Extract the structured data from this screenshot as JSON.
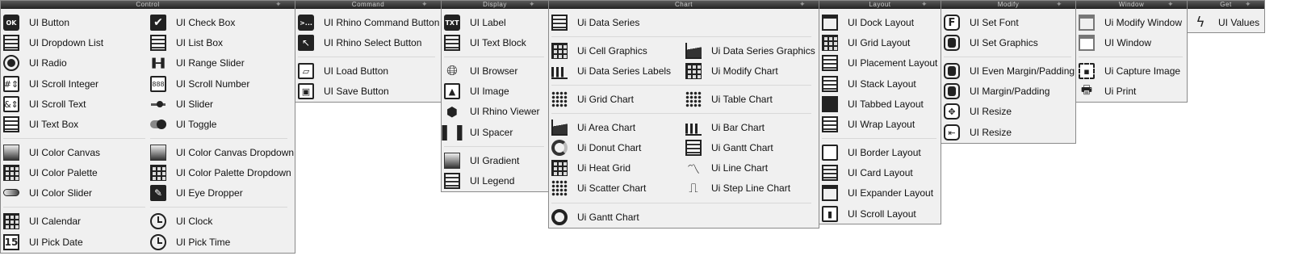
{
  "panels": {
    "control": "Control",
    "command": "Command",
    "display": "Display",
    "chart": "Chart",
    "layout": "Layout",
    "modify": "Modify",
    "window": "Window",
    "get": "Get"
  },
  "control": {
    "col1": [
      "UI Button",
      "UI Dropdown List",
      "UI Radio",
      "UI Scroll Integer",
      "UI Scroll Text",
      "UI Text Box",
      "UI Color Canvas",
      "UI Color Palette",
      "UI Color Slider",
      "UI Calendar",
      "UI Pick Date"
    ],
    "col2": [
      "UI Check Box",
      "UI List Box",
      "UI Range Slider",
      "UI Scroll Number",
      "UI Slider",
      "UI Toggle",
      "UI Color Canvas Dropdown",
      "UI Color Palette Dropdown",
      "UI Eye Dropper",
      "UI Clock",
      "UI Pick Time"
    ],
    "button_icon": "OK",
    "pick_date_icon": "15"
  },
  "command": {
    "items": [
      "UI Rhino Command Button",
      "UI Rhino Select Button",
      "UI Load Button",
      "UI Save Button"
    ],
    "command_icon": ">..."
  },
  "display": {
    "items": [
      "UI Label",
      "UI Text Block",
      "UI Browser",
      "UI Image",
      "UI Rhino Viewer",
      "UI Spacer",
      "UI Gradient",
      "UI Legend"
    ],
    "label_icon": "TXT"
  },
  "chart": {
    "top": "Ui Data Series",
    "col1": [
      "Ui Cell Graphics",
      "Ui Data Series Labels",
      "Ui Grid Chart",
      "Ui Area Chart",
      "Ui Donut Chart",
      "Ui Heat Grid",
      "Ui Scatter Chart"
    ],
    "col2": [
      "Ui Data Series Graphics",
      "Ui Modify Chart",
      "Ui Table Chart",
      "Ui Bar Chart",
      "Ui Gantt Chart",
      "Ui Line Chart",
      "Ui Step Line Chart"
    ],
    "bottom": "Ui Gantt Chart"
  },
  "layout": {
    "items": [
      "UI Dock Layout",
      "UI Grid Layout",
      "UI Placement Layout",
      "UI Stack Layout",
      "UI Tabbed Layout",
      "UI Wrap Layout",
      "UI Border Layout",
      "UI Card Layout",
      "UI Expander Layout",
      "UI Scroll Layout"
    ]
  },
  "modify": {
    "items": [
      "UI Set Font",
      "UI Set Graphics",
      "UI Even Margin/Padding",
      "UI Margin/Padding",
      "UI Resize",
      "UI Resize"
    ],
    "font_icon": "F"
  },
  "window": {
    "items": [
      "Ui Modify Window",
      "UI Window",
      "Ui Capture Image",
      "Ui Print"
    ]
  },
  "get": {
    "items": [
      "UI Values"
    ]
  }
}
